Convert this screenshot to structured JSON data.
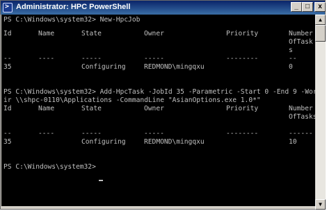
{
  "window": {
    "title": "Administrator: HPC PowerShell",
    "icon_glyph": ">",
    "controls": {
      "minimize": "_",
      "maximize": "□",
      "close": "x"
    }
  },
  "console": {
    "cmd1": "PS C:\\Windows\\system32> New-HpcJob",
    "table1": {
      "headers": [
        "Id",
        "Name",
        "State",
        "Owner",
        "Priority",
        "Number"
      ],
      "header2": "OfTask",
      "header3": "s",
      "rule": [
        "--",
        "----",
        "-----",
        "-----",
        "--------",
        "--"
      ],
      "row": [
        "35",
        "",
        "Configuring",
        "REDMOND\\mingqxu",
        "",
        "0"
      ]
    },
    "cmd2_line1": "PS C:\\Windows\\system32> Add-HpcTask -JobId 35 -Parametric -Start 0 -End 9 -WorkD",
    "cmd2_line2": "ir \\\\shpc-0110\\Applications -CommandLine \"AsianOptions.exe 1.0*\"",
    "table2": {
      "headers": [
        "Id",
        "Name",
        "State",
        "Owner",
        "Priority",
        "Number"
      ],
      "header2": "OfTasks",
      "rule": [
        "--",
        "----",
        "-----",
        "-----",
        "--------",
        "------"
      ],
      "row": [
        "35",
        "",
        "Configuring",
        "REDMOND\\mingqxu",
        "",
        "10"
      ]
    },
    "prompt": "PS C:\\Windows\\system32> "
  },
  "scrollbar": {
    "up": "▲",
    "down": "▼"
  },
  "colors": {
    "console_bg": "#000000",
    "console_text": "#c0c0c0",
    "titlebar": "#0a246a",
    "chrome": "#d4d0c8"
  }
}
